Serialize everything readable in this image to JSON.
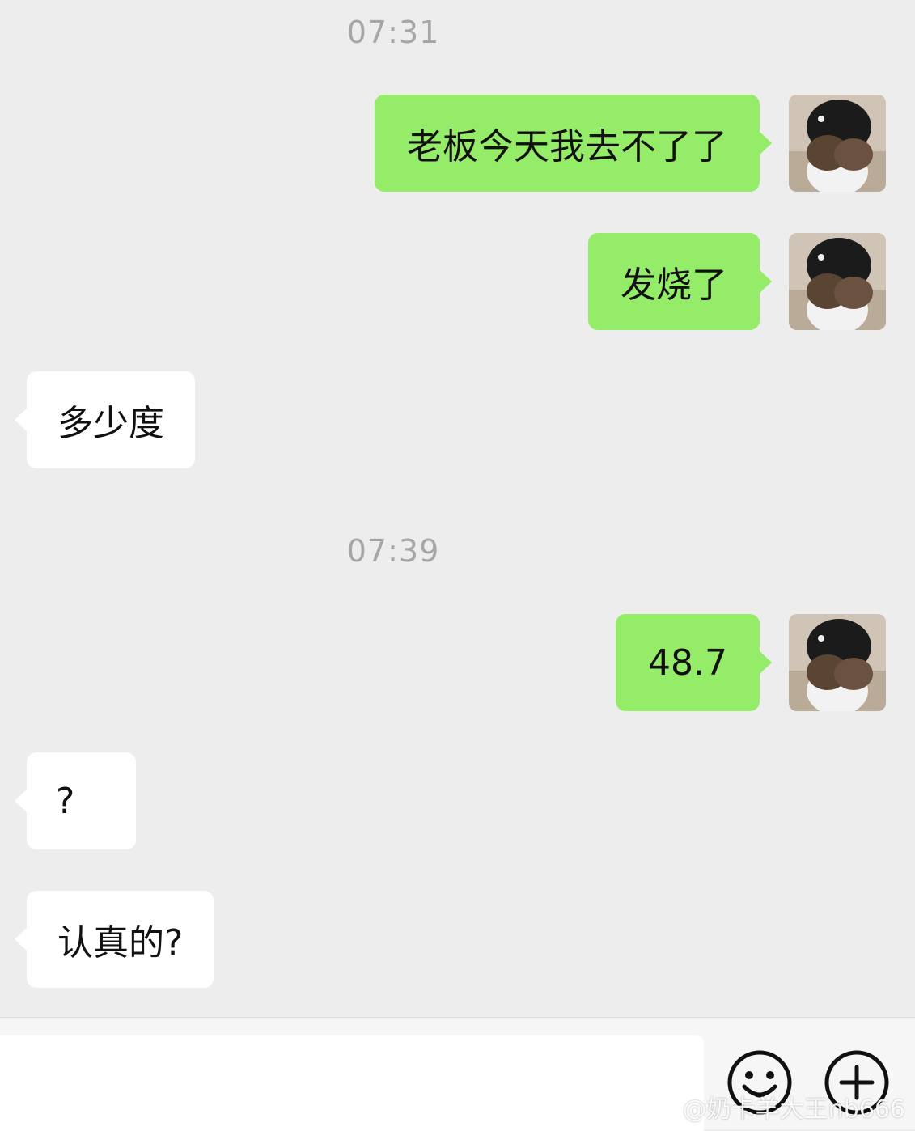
{
  "timestamps": [
    "07:31",
    "07:39"
  ],
  "messages": [
    {
      "side": "right",
      "text": "老板今天我去不了了"
    },
    {
      "side": "right",
      "text": "发烧了"
    },
    {
      "side": "left",
      "text": "多少度"
    },
    {
      "side": "right",
      "text": "48.7"
    },
    {
      "side": "left",
      "text": "?"
    },
    {
      "side": "left",
      "text": "认真的?"
    }
  ],
  "input_bar": {
    "text_value": "",
    "emoji_icon": "smiley-face-icon",
    "more_icon": "plus-circle-icon"
  },
  "watermark": {
    "text": "@奶卡羊大王nb666",
    "icon": "weibo-logo-icon"
  },
  "colors": {
    "background": "#ededed",
    "sent_bubble": "#95ec69",
    "received_bubble": "#ffffff",
    "timestamp": "#a6a6a6"
  }
}
